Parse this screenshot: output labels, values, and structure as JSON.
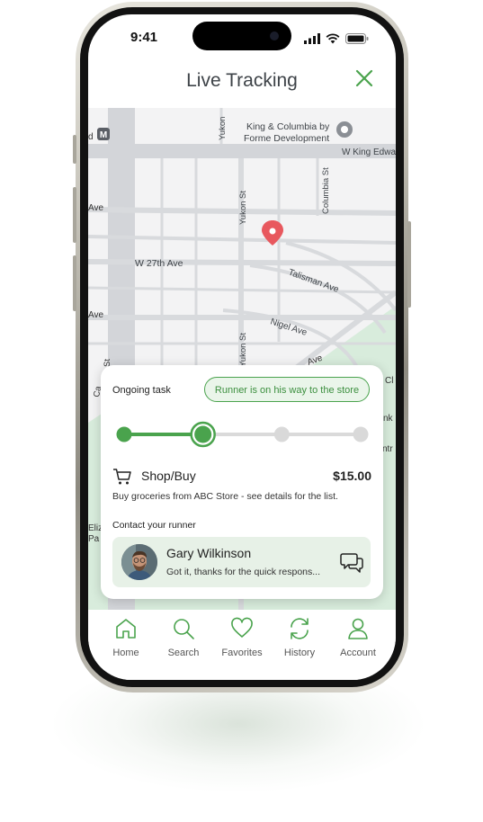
{
  "status_bar": {
    "time": "9:41"
  },
  "header": {
    "title": "Live Tracking",
    "close_icon": "close-icon"
  },
  "map": {
    "labels": {
      "king_columbia": "King & Columbia by",
      "king_columbia_2": "Forme Development",
      "w_king_edward": "W King Edwa",
      "yukon_top": "Yukon",
      "yukon_st": "Yukon St",
      "columbia_st": "Columbia St",
      "w_27th": "W 27th Ave",
      "talisman": "Talisman Ave",
      "nigel": "Nigel Ave",
      "yukon_bottom": "Yukon St",
      "ave_1": "Ave",
      "ave_2": "Ave",
      "ave_3": "Ave",
      "d_m": "d",
      "st_left": "St",
      "ca_left": "Ca",
      "eliz": "Eliz",
      "pa": "Pa",
      "cl_right": "Cl",
      "nk_right": "nk",
      "ntr_right": "ntr",
      "m_badge": "M"
    },
    "accent_park": "#d8ecdc",
    "marker_color": "#e8585e"
  },
  "task": {
    "label": "Ongoing task",
    "status": "Runner is on his way to the store",
    "progress": {
      "steps": 4,
      "current_step": 2
    },
    "service_icon": "cart-icon",
    "service_name": "Shop/Buy",
    "price": "$15.00",
    "description": "Buy groceries from ABC Store - see details for the list.",
    "contact_label": "Contact your runner",
    "runner": {
      "name": "Gary Wilkinson",
      "last_message": "Got it, thanks for the quick respons...",
      "chat_icon": "chat-bubbles-icon"
    }
  },
  "tabs": [
    {
      "label": "Home",
      "icon": "home-icon"
    },
    {
      "label": "Search",
      "icon": "search-icon"
    },
    {
      "label": "Favorites",
      "icon": "heart-icon"
    },
    {
      "label": "History",
      "icon": "refresh-icon"
    },
    {
      "label": "Account",
      "icon": "user-icon"
    }
  ],
  "colors": {
    "accent": "#4aa34d",
    "accent_light": "#e7f1e7",
    "text": "#222222"
  }
}
